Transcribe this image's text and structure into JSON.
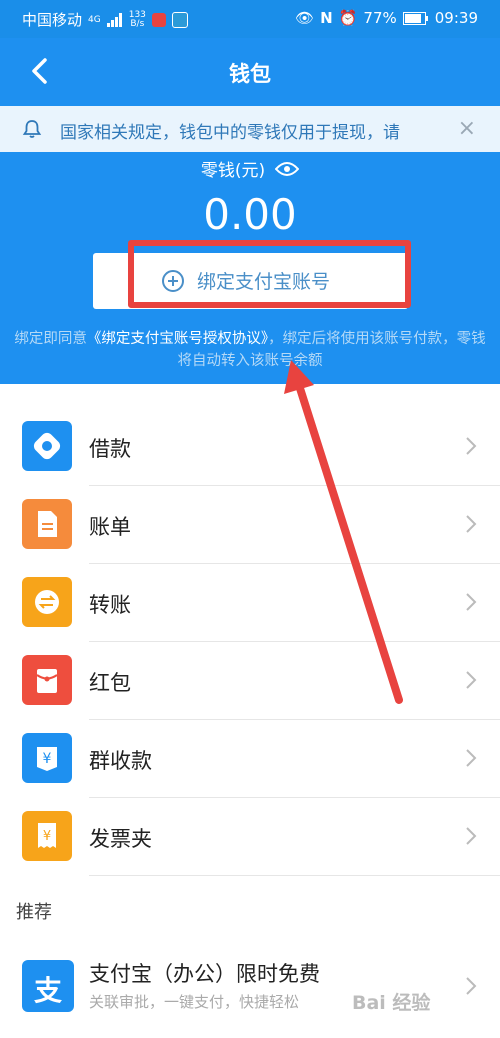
{
  "status": {
    "carrier": "中国移动",
    "network": "4G",
    "speed_top": "133",
    "speed_bottom": "B/s",
    "battery": "77%",
    "time": "09:39"
  },
  "header": {
    "title": "钱包"
  },
  "notice": {
    "text": "国家相关规定，钱包中的零钱仅用于提现，请"
  },
  "balance": {
    "label": "零钱(元)",
    "amount": "0.00",
    "bind_label": "绑定支付宝账号",
    "agree_prefix": "绑定即同意",
    "agree_link": "《绑定支付宝账号授权协议》",
    "agree_suffix": "，绑定后将使用该账号付款，零钱将自动转入该账号余额"
  },
  "menu": [
    {
      "label": "借款",
      "icon": "loan-icon",
      "color": "#1e90f0"
    },
    {
      "label": "账单",
      "icon": "bill-icon",
      "color": "#f58b3c"
    },
    {
      "label": "转账",
      "icon": "transfer-icon",
      "color": "#f7a41a"
    },
    {
      "label": "红包",
      "icon": "red-packet-icon",
      "color": "#ee4e3e"
    },
    {
      "label": "群收款",
      "icon": "group-collect-icon",
      "color": "#1e90f0"
    },
    {
      "label": "发票夹",
      "icon": "invoice-icon",
      "color": "#f7a41a"
    }
  ],
  "recommend": {
    "section_title": "推荐",
    "title": "支付宝（办公）限时免费",
    "subtitle": "关联审批，一键支付，快捷轻松",
    "icon_char": "支"
  },
  "watermark": "Bai 经验",
  "colors": {
    "brand": "#1e90f0",
    "highlight": "#e8433f"
  }
}
